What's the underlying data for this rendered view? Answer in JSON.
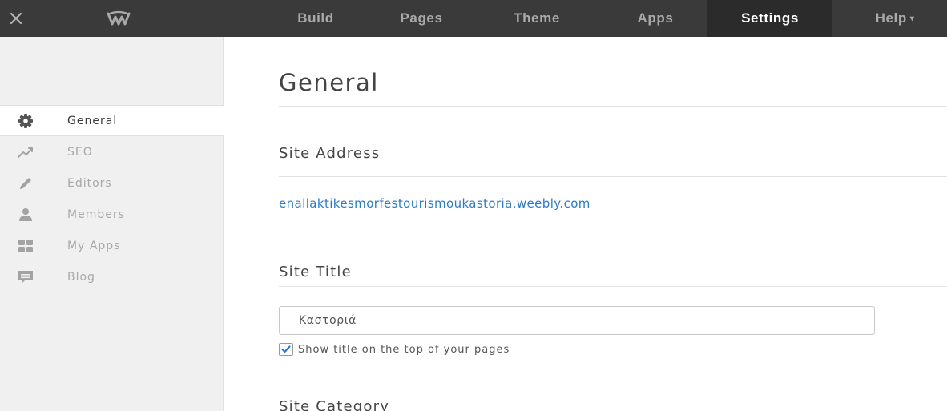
{
  "topbar": {
    "close_icon": "close-icon",
    "logo_icon": "weebly-logo-icon",
    "nav": [
      {
        "label": "Build",
        "active": false
      },
      {
        "label": "Pages",
        "active": false
      },
      {
        "label": "Theme",
        "active": false
      },
      {
        "label": "Apps",
        "active": false
      },
      {
        "label": "Settings",
        "active": true
      },
      {
        "label": "Help",
        "active": false
      }
    ],
    "help_caret": "▾"
  },
  "sidebar": {
    "items": [
      {
        "label": "General",
        "icon": "gear-icon",
        "active": true
      },
      {
        "label": "SEO",
        "icon": "trend-line-icon",
        "active": false
      },
      {
        "label": "Editors",
        "icon": "pencil-icon",
        "active": false
      },
      {
        "label": "Members",
        "icon": "user-icon",
        "active": false
      },
      {
        "label": "My Apps",
        "icon": "apps-grid-icon",
        "active": false
      },
      {
        "label": "Blog",
        "icon": "chat-bubble-icon",
        "active": false
      }
    ]
  },
  "main": {
    "title": "General",
    "site_address": {
      "heading": "Site Address",
      "url": "enallaktikesmorfestourismoukastoria.weebly.com"
    },
    "site_title": {
      "heading": "Site Title",
      "value": "Καστοριά",
      "show_title_checked": true,
      "show_title_label": "Show title on the top of your pages"
    },
    "site_category": {
      "heading": "Site Category"
    }
  },
  "colors": {
    "topbar_bg": "#3a3a3a",
    "active_nav_bg": "#2b2b2b",
    "sidebar_bg": "#f0f0f0",
    "link": "#2a7ad2",
    "icon_gray": "#a3a3a3",
    "icon_dark": "#555555",
    "check_blue": "#2a7ad2"
  }
}
